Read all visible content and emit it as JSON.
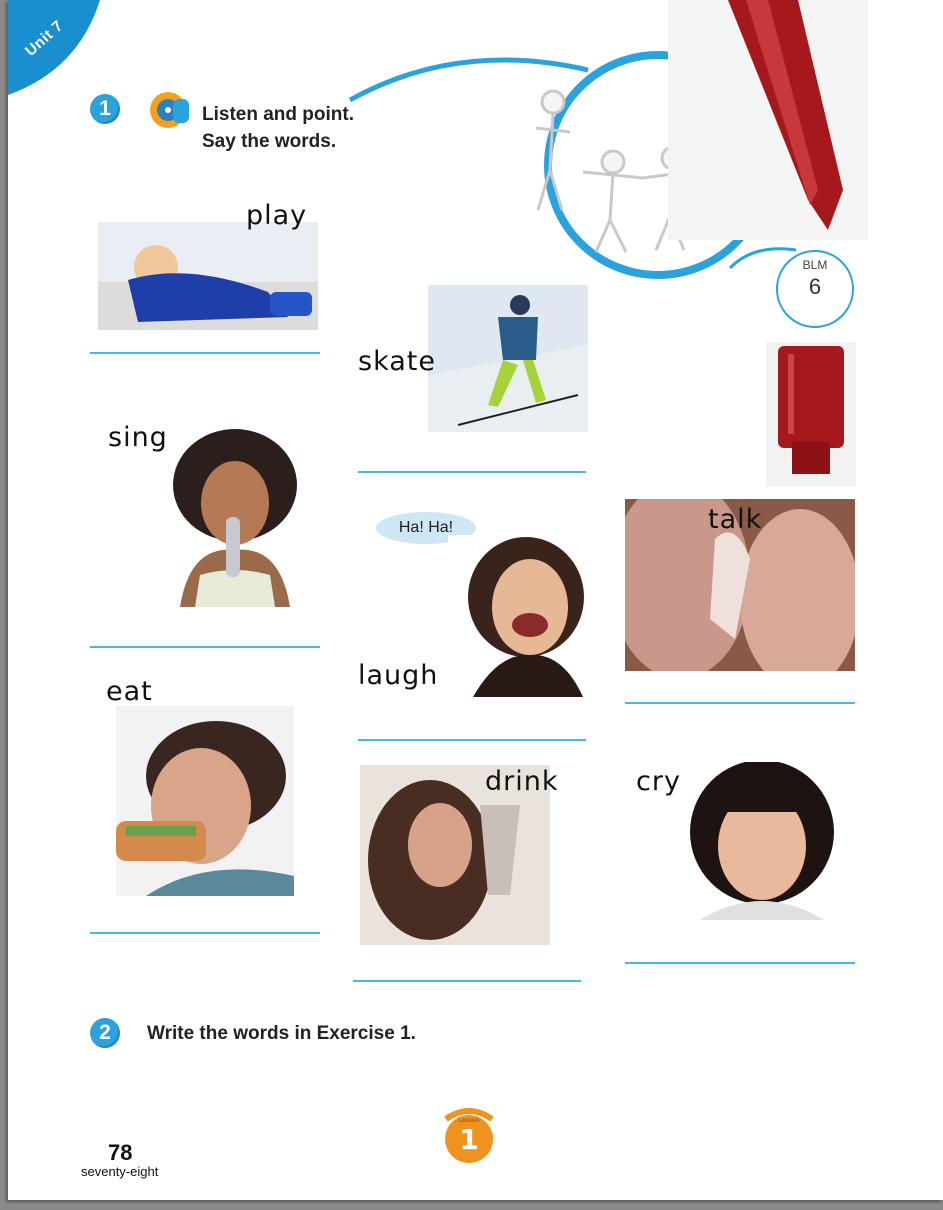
{
  "unit_label": "Unit 7",
  "exercise1": {
    "number": "1",
    "line1": "Listen and point.",
    "line2": "Say the words."
  },
  "exercise2": {
    "number": "2",
    "text": "Write the words in Exercise 1."
  },
  "blm": {
    "label": "BLM",
    "number": "6"
  },
  "speech_bubble": "Ha! Ha!",
  "words": {
    "play": "play",
    "skate": "skate",
    "sing": "sing",
    "talk": "talk",
    "laugh": "laugh",
    "eat": "eat",
    "drink": "drink",
    "cry": "cry"
  },
  "lesson_badge": {
    "label": "Lesson",
    "number": "1"
  },
  "page_number": "78",
  "page_word": "seventy-eight",
  "colors": {
    "accent_blue": "#2aa3dc",
    "line_blue": "#47b7e3",
    "lesson_orange": "#f0921e"
  }
}
